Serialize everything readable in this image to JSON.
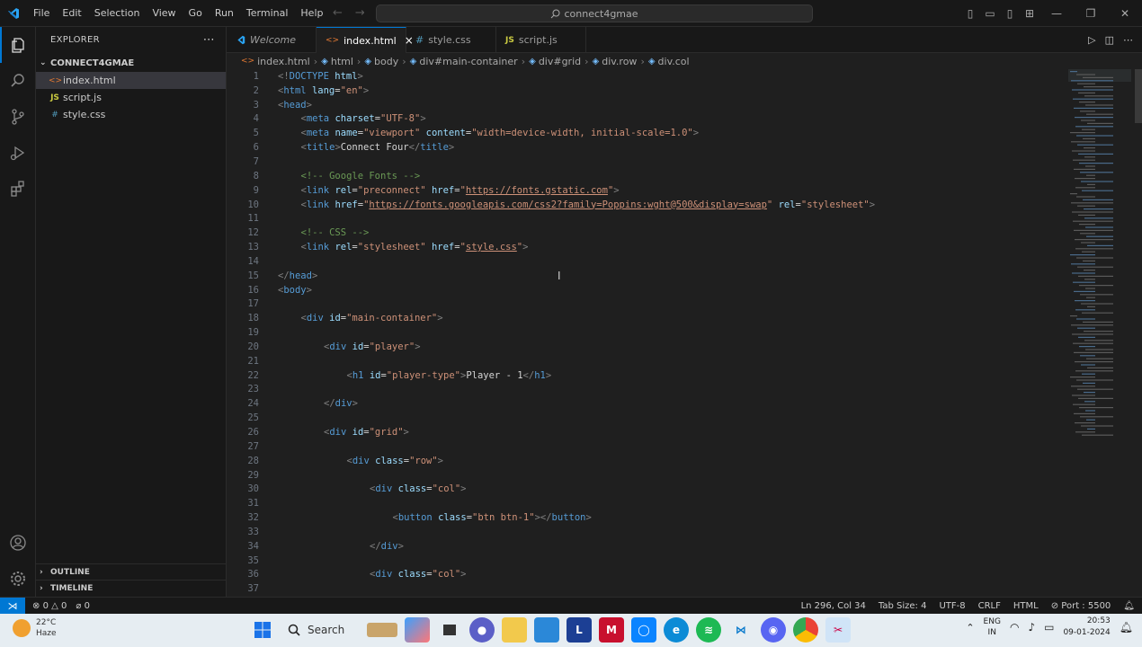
{
  "titlebar": {
    "menu": [
      "File",
      "Edit",
      "Selection",
      "View",
      "Go",
      "Run",
      "Terminal",
      "Help"
    ],
    "search": "connect4gmae"
  },
  "sidebar": {
    "title": "EXPLORER",
    "folder": "CONNECT4GMAE",
    "files": [
      {
        "name": "index.html",
        "icon": "<>",
        "color": "#e37933",
        "selected": true
      },
      {
        "name": "script.js",
        "icon": "JS",
        "color": "#cbcb41",
        "selected": false
      },
      {
        "name": "style.css",
        "icon": "#",
        "color": "#519aba",
        "selected": false
      }
    ],
    "outline": "OUTLINE",
    "timeline": "TIMELINE"
  },
  "tabs": [
    {
      "label": "Welcome",
      "icon": "vscode",
      "active": false
    },
    {
      "label": "index.html",
      "icon": "<>",
      "active": true,
      "close": "×"
    },
    {
      "label": "style.css",
      "icon": "#",
      "active": false
    },
    {
      "label": "script.js",
      "icon": "JS",
      "active": false
    }
  ],
  "breadcrumb": [
    "index.html",
    "html",
    "body",
    "div#main-container",
    "div#grid",
    "div.row",
    "div.col"
  ],
  "code": [
    {
      "n": "1",
      "i": 0,
      "t": [
        [
          "tg",
          "<!"
        ],
        [
          "tn",
          "DOCTYPE"
        ],
        [
          "tx",
          " "
        ],
        [
          "at",
          "html"
        ],
        [
          "tg",
          ">"
        ]
      ]
    },
    {
      "n": "2",
      "i": 0,
      "t": [
        [
          "tg",
          "<"
        ],
        [
          "tn",
          "html"
        ],
        [
          "tx",
          " "
        ],
        [
          "at",
          "lang"
        ],
        [
          "tx",
          "="
        ],
        [
          "st",
          "\"en\""
        ],
        [
          "tg",
          ">"
        ]
      ]
    },
    {
      "n": "3",
      "i": 0,
      "t": [
        [
          "tg",
          "<"
        ],
        [
          "tn",
          "head"
        ],
        [
          "tg",
          ">"
        ]
      ]
    },
    {
      "n": "4",
      "i": 1,
      "t": [
        [
          "tg",
          "<"
        ],
        [
          "tn",
          "meta"
        ],
        [
          "tx",
          " "
        ],
        [
          "at",
          "charset"
        ],
        [
          "tx",
          "="
        ],
        [
          "st",
          "\"UTF-8\""
        ],
        [
          "tg",
          ">"
        ]
      ]
    },
    {
      "n": "5",
      "i": 1,
      "t": [
        [
          "tg",
          "<"
        ],
        [
          "tn",
          "meta"
        ],
        [
          "tx",
          " "
        ],
        [
          "at",
          "name"
        ],
        [
          "tx",
          "="
        ],
        [
          "st",
          "\"viewport\""
        ],
        [
          "tx",
          " "
        ],
        [
          "at",
          "content"
        ],
        [
          "tx",
          "="
        ],
        [
          "st",
          "\"width=device-width, initial-scale=1.0\""
        ],
        [
          "tg",
          ">"
        ]
      ]
    },
    {
      "n": "6",
      "i": 1,
      "t": [
        [
          "tg",
          "<"
        ],
        [
          "tn",
          "title"
        ],
        [
          "tg",
          ">"
        ],
        [
          "tx",
          "Connect Four"
        ],
        [
          "tg",
          "</"
        ],
        [
          "tn",
          "title"
        ],
        [
          "tg",
          ">"
        ]
      ]
    },
    {
      "n": "7",
      "i": 0,
      "t": []
    },
    {
      "n": "8",
      "i": 1,
      "t": [
        [
          "cm",
          "<!-- Google Fonts -->"
        ]
      ]
    },
    {
      "n": "9",
      "i": 1,
      "t": [
        [
          "tg",
          "<"
        ],
        [
          "tn",
          "link"
        ],
        [
          "tx",
          " "
        ],
        [
          "at",
          "rel"
        ],
        [
          "tx",
          "="
        ],
        [
          "st",
          "\"preconnect\""
        ],
        [
          "tx",
          " "
        ],
        [
          "at",
          "href"
        ],
        [
          "tx",
          "="
        ],
        [
          "st",
          "\""
        ],
        [
          "stu",
          "https://fonts.gstatic.com"
        ],
        [
          "st",
          "\""
        ],
        [
          "tg",
          ">"
        ]
      ]
    },
    {
      "n": "10",
      "i": 1,
      "t": [
        [
          "tg",
          "<"
        ],
        [
          "tn",
          "link"
        ],
        [
          "tx",
          " "
        ],
        [
          "at",
          "href"
        ],
        [
          "tx",
          "="
        ],
        [
          "st",
          "\""
        ],
        [
          "stu",
          "https://fonts.googleapis.com/css2?family=Poppins:wght@500&display=swap"
        ],
        [
          "st",
          "\""
        ],
        [
          "tx",
          " "
        ],
        [
          "at",
          "rel"
        ],
        [
          "tx",
          "="
        ],
        [
          "st",
          "\"stylesheet\""
        ],
        [
          "tg",
          ">"
        ]
      ]
    },
    {
      "n": "11",
      "i": 0,
      "t": []
    },
    {
      "n": "12",
      "i": 1,
      "t": [
        [
          "cm",
          "<!-- CSS -->"
        ]
      ]
    },
    {
      "n": "13",
      "i": 1,
      "t": [
        [
          "tg",
          "<"
        ],
        [
          "tn",
          "link"
        ],
        [
          "tx",
          " "
        ],
        [
          "at",
          "rel"
        ],
        [
          "tx",
          "="
        ],
        [
          "st",
          "\"stylesheet\""
        ],
        [
          "tx",
          " "
        ],
        [
          "at",
          "href"
        ],
        [
          "tx",
          "="
        ],
        [
          "st",
          "\""
        ],
        [
          "stu",
          "style.css"
        ],
        [
          "st",
          "\""
        ],
        [
          "tg",
          ">"
        ]
      ]
    },
    {
      "n": "14",
      "i": 0,
      "t": []
    },
    {
      "n": "15",
      "i": 0,
      "t": [
        [
          "tg",
          "</"
        ],
        [
          "tn",
          "head"
        ],
        [
          "tg",
          ">"
        ]
      ]
    },
    {
      "n": "16",
      "i": 0,
      "t": [
        [
          "tg",
          "<"
        ],
        [
          "tn",
          "body"
        ],
        [
          "tg",
          ">"
        ]
      ]
    },
    {
      "n": "17",
      "i": 0,
      "t": []
    },
    {
      "n": "18",
      "i": 1,
      "t": [
        [
          "tg",
          "<"
        ],
        [
          "tn",
          "div"
        ],
        [
          "tx",
          " "
        ],
        [
          "at",
          "id"
        ],
        [
          "tx",
          "="
        ],
        [
          "st",
          "\"main-container\""
        ],
        [
          "tg",
          ">"
        ]
      ]
    },
    {
      "n": "19",
      "i": 0,
      "t": []
    },
    {
      "n": "20",
      "i": 2,
      "t": [
        [
          "tg",
          "<"
        ],
        [
          "tn",
          "div"
        ],
        [
          "tx",
          " "
        ],
        [
          "at",
          "id"
        ],
        [
          "tx",
          "="
        ],
        [
          "st",
          "\"player\""
        ],
        [
          "tg",
          ">"
        ]
      ]
    },
    {
      "n": "21",
      "i": 0,
      "t": []
    },
    {
      "n": "22",
      "i": 3,
      "t": [
        [
          "tg",
          "<"
        ],
        [
          "tn",
          "h1"
        ],
        [
          "tx",
          " "
        ],
        [
          "at",
          "id"
        ],
        [
          "tx",
          "="
        ],
        [
          "st",
          "\"player-type\""
        ],
        [
          "tg",
          ">"
        ],
        [
          "tx",
          "Player - 1"
        ],
        [
          "tg",
          "</"
        ],
        [
          "tn",
          "h1"
        ],
        [
          "tg",
          ">"
        ]
      ]
    },
    {
      "n": "23",
      "i": 0,
      "t": []
    },
    {
      "n": "24",
      "i": 2,
      "t": [
        [
          "tg",
          "</"
        ],
        [
          "tn",
          "div"
        ],
        [
          "tg",
          ">"
        ]
      ]
    },
    {
      "n": "25",
      "i": 0,
      "t": []
    },
    {
      "n": "26",
      "i": 2,
      "t": [
        [
          "tg",
          "<"
        ],
        [
          "tn",
          "div"
        ],
        [
          "tx",
          " "
        ],
        [
          "at",
          "id"
        ],
        [
          "tx",
          "="
        ],
        [
          "st",
          "\"grid\""
        ],
        [
          "tg",
          ">"
        ]
      ]
    },
    {
      "n": "27",
      "i": 0,
      "t": []
    },
    {
      "n": "28",
      "i": 3,
      "t": [
        [
          "tg",
          "<"
        ],
        [
          "tn",
          "div"
        ],
        [
          "tx",
          " "
        ],
        [
          "at",
          "class"
        ],
        [
          "tx",
          "="
        ],
        [
          "st",
          "\"row\""
        ],
        [
          "tg",
          ">"
        ]
      ]
    },
    {
      "n": "29",
      "i": 0,
      "t": []
    },
    {
      "n": "30",
      "i": 4,
      "t": [
        [
          "tg",
          "<"
        ],
        [
          "tn",
          "div"
        ],
        [
          "tx",
          " "
        ],
        [
          "at",
          "class"
        ],
        [
          "tx",
          "="
        ],
        [
          "st",
          "\"col\""
        ],
        [
          "tg",
          ">"
        ]
      ]
    },
    {
      "n": "31",
      "i": 0,
      "t": []
    },
    {
      "n": "32",
      "i": 5,
      "t": [
        [
          "tg",
          "<"
        ],
        [
          "tn",
          "button"
        ],
        [
          "tx",
          " "
        ],
        [
          "at",
          "class"
        ],
        [
          "tx",
          "="
        ],
        [
          "st",
          "\"btn btn-1\""
        ],
        [
          "tg",
          "></"
        ],
        [
          "tn",
          "button"
        ],
        [
          "tg",
          ">"
        ]
      ]
    },
    {
      "n": "33",
      "i": 0,
      "t": []
    },
    {
      "n": "34",
      "i": 4,
      "t": [
        [
          "tg",
          "</"
        ],
        [
          "tn",
          "div"
        ],
        [
          "tg",
          ">"
        ]
      ]
    },
    {
      "n": "35",
      "i": 0,
      "t": []
    },
    {
      "n": "36",
      "i": 4,
      "t": [
        [
          "tg",
          "<"
        ],
        [
          "tn",
          "div"
        ],
        [
          "tx",
          " "
        ],
        [
          "at",
          "class"
        ],
        [
          "tx",
          "="
        ],
        [
          "st",
          "\"col\""
        ],
        [
          "tg",
          ">"
        ]
      ]
    },
    {
      "n": "37",
      "i": 0,
      "t": []
    }
  ],
  "status": {
    "errors": "0",
    "warnings": "0",
    "ports_left": "0",
    "position": "Ln 296, Col 34",
    "tab_size": "Tab Size: 4",
    "encoding": "UTF-8",
    "eol": "CRLF",
    "language": "HTML",
    "port": "Port : 5500"
  },
  "taskbar": {
    "temp": "22°C",
    "weather": "Haze",
    "search": "Search",
    "lang1": "ENG",
    "lang2": "IN",
    "time": "20:53",
    "date": "09-01-2024"
  },
  "colors": {
    "accent": "#0078d4",
    "tag": "#569cd6",
    "attr": "#9cdcfe",
    "string": "#ce9178",
    "comment": "#6a9955"
  }
}
